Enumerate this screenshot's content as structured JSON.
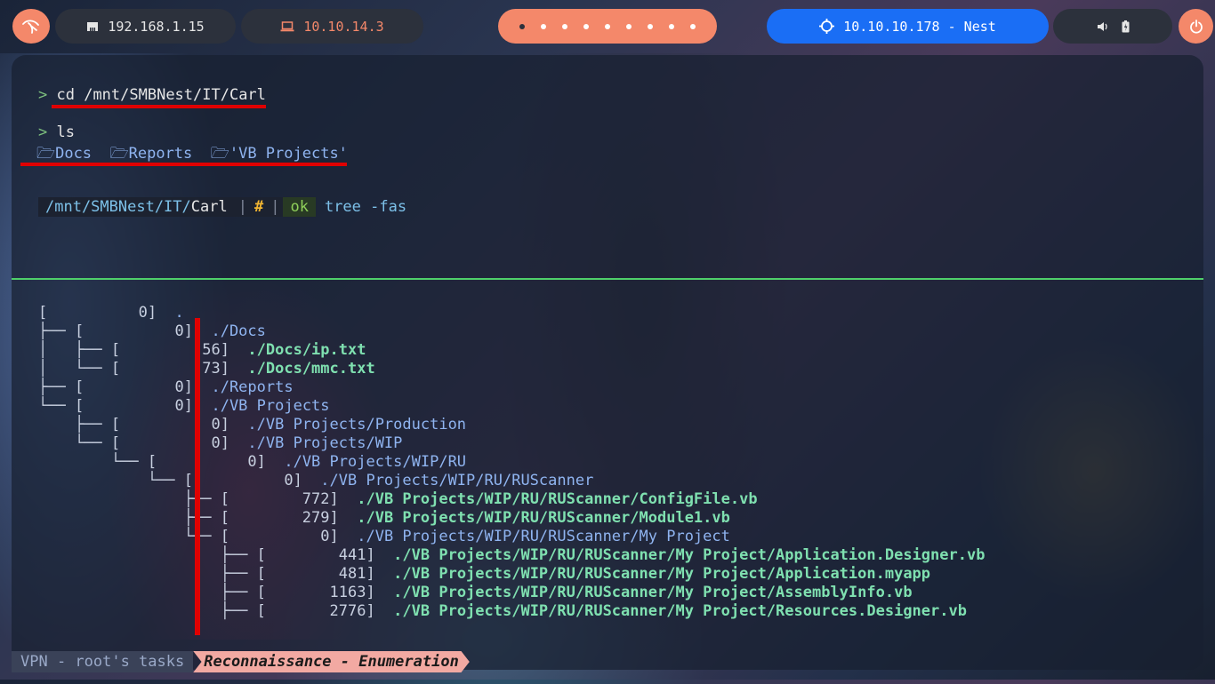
{
  "topbar": {
    "local_ip": "192.168.1.15",
    "vpn_ip": "10.10.14.3",
    "target": "10.10.10.178 - Nest",
    "workspaces": 9,
    "active_workspace": 1,
    "colors": {
      "accent": "#f4886a",
      "target_bg": "#1a6ef5",
      "pill_bg": "#2c313c"
    }
  },
  "terminal": {
    "cmd1_prompt": ">",
    "cmd1": "cd /mnt/SMBNest/IT/Carl",
    "cmd2_prompt": ">",
    "cmd2": "ls",
    "ls_items": [
      "Docs",
      "Reports",
      "'VB Projects'"
    ],
    "status": {
      "path_prefix": "/mnt/SMBNest/IT/",
      "path_current": "Carl",
      "sep1": "|",
      "hash": "#",
      "sep2": "|",
      "ok": "ok",
      "command": "tree -fas"
    },
    "tree_lines": [
      {
        "prefix": "[          0]  ",
        "path": ".",
        "kind": "dir"
      },
      {
        "prefix": "├── [          0]  ",
        "path": "./Docs",
        "kind": "dir"
      },
      {
        "prefix": "│   ├── [         56]  ",
        "path": "./Docs/ip.txt",
        "kind": "file"
      },
      {
        "prefix": "│   └── [         73]  ",
        "path": "./Docs/mmc.txt",
        "kind": "file"
      },
      {
        "prefix": "├── [          0]  ",
        "path": "./Reports",
        "kind": "dir"
      },
      {
        "prefix": "└── [          0]  ",
        "path": "./VB Projects",
        "kind": "dir"
      },
      {
        "prefix": "    ├── [          0]  ",
        "path": "./VB Projects/Production",
        "kind": "dir"
      },
      {
        "prefix": "    └── [          0]  ",
        "path": "./VB Projects/WIP",
        "kind": "dir"
      },
      {
        "prefix": "        └── [          0]  ",
        "path": "./VB Projects/WIP/RU",
        "kind": "dir"
      },
      {
        "prefix": "            └── [          0]  ",
        "path": "./VB Projects/WIP/RU/RUScanner",
        "kind": "dir"
      },
      {
        "prefix": "                ├── [        772]  ",
        "path": "./VB Projects/WIP/RU/RUScanner/ConfigFile.vb",
        "kind": "file"
      },
      {
        "prefix": "                ├── [        279]  ",
        "path": "./VB Projects/WIP/RU/RUScanner/Module1.vb",
        "kind": "file"
      },
      {
        "prefix": "                └── [          0]  ",
        "path": "./VB Projects/WIP/RU/RUScanner/My Project",
        "kind": "dir"
      },
      {
        "prefix": "                    ├── [        441]  ",
        "path": "./VB Projects/WIP/RU/RUScanner/My Project/Application.Designer.vb",
        "kind": "file"
      },
      {
        "prefix": "                    ├── [        481]  ",
        "path": "./VB Projects/WIP/RU/RUScanner/My Project/Application.myapp",
        "kind": "file"
      },
      {
        "prefix": "                    ├── [       1163]  ",
        "path": "./VB Projects/WIP/RU/RUScanner/My Project/AssemblyInfo.vb",
        "kind": "file"
      },
      {
        "prefix": "                    ├── [       2776]  ",
        "path": "./VB Projects/WIP/RU/RUScanner/My Project/Resources.Designer.vb",
        "kind": "file"
      }
    ]
  },
  "bottombar": {
    "session": "VPN - root's tasks",
    "task": "Reconnaissance - Enumeration"
  }
}
